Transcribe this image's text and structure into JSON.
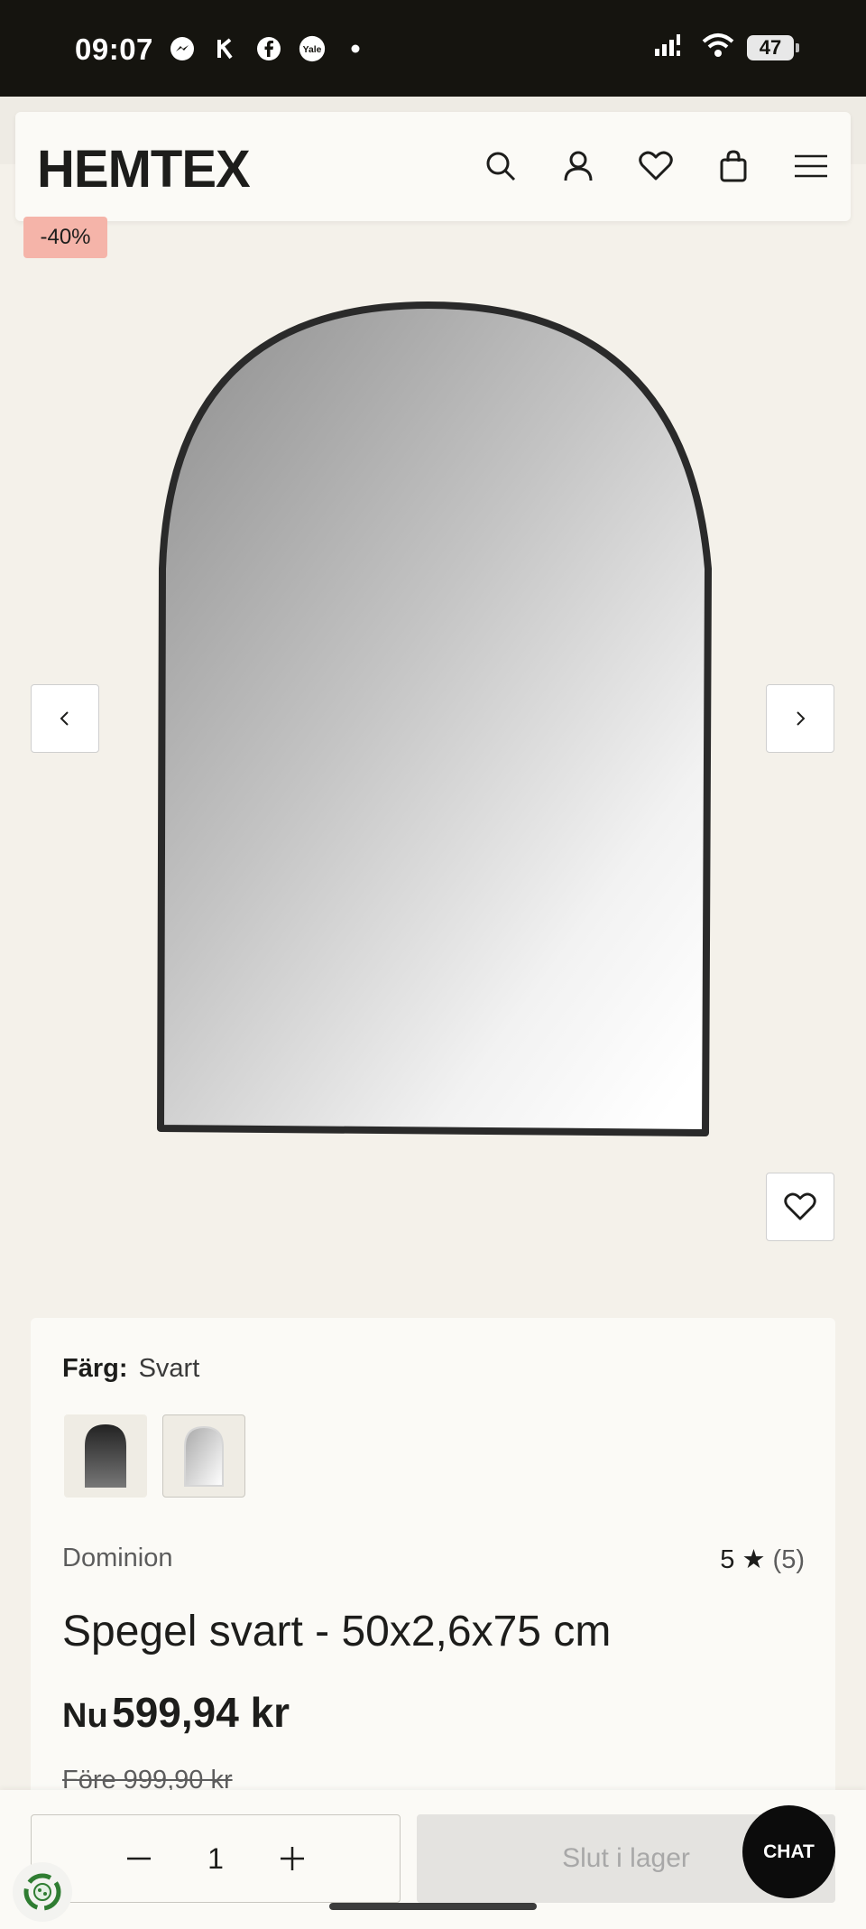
{
  "status_bar": {
    "time": "09:07",
    "left_icons": [
      "messenger-icon",
      "klarna-icon",
      "facebook-icon",
      "yale-icon",
      "dot-icon"
    ],
    "battery": "47"
  },
  "header": {
    "logo": "HEMTEX",
    "icons": [
      "search-icon",
      "account-icon",
      "heart-icon",
      "bag-icon",
      "menu-icon"
    ]
  },
  "gallery": {
    "discount_badge": "-40%"
  },
  "product": {
    "color_label": "Färg:",
    "color_value": "Svart",
    "swatches": [
      "black-mirror",
      "white-mirror"
    ],
    "brand": "Dominion",
    "rating_value": "5",
    "rating_count": "(5)",
    "title": "Spegel svart - 50x2,6x75 cm",
    "price_prefix": "Nu",
    "price": "599,94 kr",
    "old_price": "Före 999,90 kr"
  },
  "purchase_bar": {
    "quantity": "1",
    "sold_out_label": "Slut i lager",
    "chat_label": "CHAT"
  },
  "colors": {
    "accent_badge": "#f5b4a9",
    "page_bg": "#f4f1ea",
    "card_bg": "#fbfaf6",
    "text": "#1d1d1b"
  }
}
